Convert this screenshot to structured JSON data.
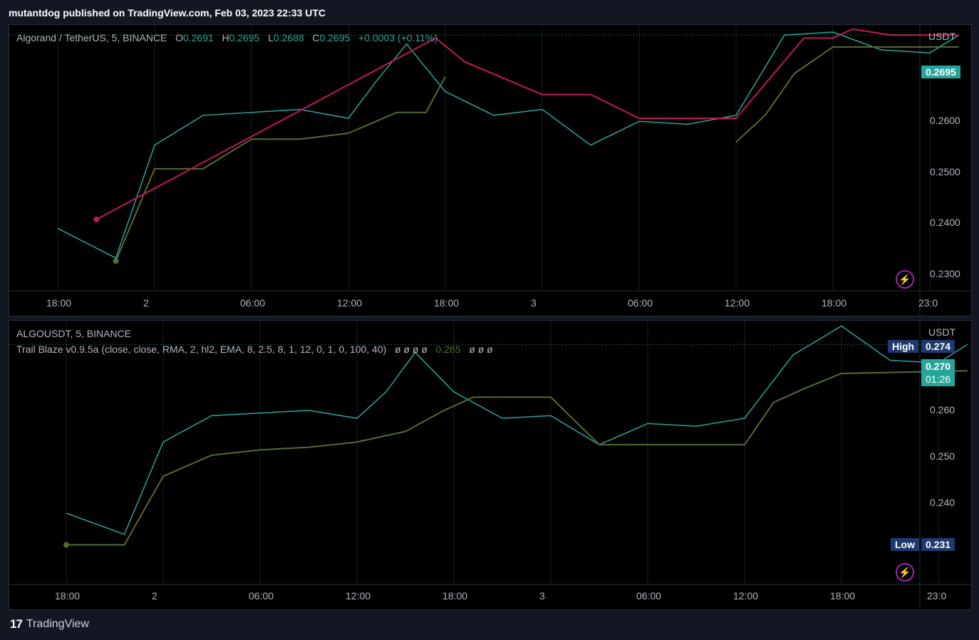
{
  "caption": "mutantdog published on TradingView.com, Feb 03, 2023 22:33 UTC",
  "footer": {
    "logo_mark": "17",
    "brand": "TradingView"
  },
  "colors": {
    "background": "#000000",
    "frame": "#131722",
    "up_candle": "#26a69a",
    "down_candle": "#ef5350",
    "trail_long": "#556b2f",
    "trail_short": "#c2185b",
    "last_price": "#26a69a",
    "high_low_tag": "#1e3a6e"
  },
  "time_axis": [
    "18:00",
    "2",
    "06:00",
    "12:00",
    "18:00",
    "3",
    "06:00",
    "12:00",
    "18:00",
    "23:0"
  ],
  "top_pane": {
    "legend": {
      "symbol": "Algorand / TetherUS, 5, BINANCE",
      "open_label": "O",
      "open": "0.2691",
      "high_label": "H",
      "high": "0.2695",
      "low_label": "L",
      "low": "0.2688",
      "close_label": "C",
      "close": "0.2695",
      "change": "+0.0003 (+0.11%)"
    },
    "currency": "USDT",
    "last_price": "0.2695",
    "price_ticks": [
      "0.2600",
      "0.2500",
      "0.2400",
      "0.2300"
    ]
  },
  "bottom_pane": {
    "legend": {
      "symbol": "ALGOUSDT, 5, BINANCE",
      "indicator": "Trail Blaze v0.9.5a (close, close, RMA, 2, hl2, EMA, 8, 2.5, 8, 1, 12, 0, 1, 0, 100, 40)",
      "values_a": "ø ø ø ø",
      "trail_value": "0.265",
      "values_b": "ø ø ø"
    },
    "currency": "USDT",
    "high_label": "High",
    "high_value": "0.274",
    "last_price": "0.270",
    "countdown": "01:26",
    "low_label": "Low",
    "low_value": "0.231",
    "price_ticks": [
      "0.260",
      "0.250",
      "0.240"
    ]
  },
  "chart_data": [
    {
      "type": "line",
      "title": "Algorand / TetherUS, 5, BINANCE",
      "x_labels": [
        "18:00",
        "2",
        "06:00",
        "12:00",
        "18:00",
        "3",
        "06:00",
        "12:00",
        "18:00",
        "23:0"
      ],
      "y_unit": "USDT",
      "ylim": [
        0.2265,
        0.2712
      ],
      "series": [
        {
          "name": "",
          "x": [
            0,
            0.6,
            1.0,
            1.5,
            2.0,
            2.5,
            3.0,
            3.3,
            3.6,
            4.0,
            4.5,
            5.0,
            5.5,
            6.0,
            6.5,
            7.0,
            7.5,
            8.0,
            8.5,
            9.0,
            9.3
          ],
          "y": [
            0.237,
            0.232,
            0.251,
            0.256,
            0.2565,
            0.257,
            0.2555,
            0.262,
            0.268,
            0.26,
            0.256,
            0.257,
            0.251,
            0.255,
            0.2545,
            0.256,
            0.2695,
            0.27,
            0.267,
            0.2665,
            0.2695
          ]
        },
        {
          "name": "",
          "x": [
            0.6,
            1.0,
            1.5,
            2.0,
            2.5,
            3.0,
            3.5,
            3.8,
            4.0,
            5.0,
            6.0,
            7.0,
            7.3,
            7.6,
            8.0,
            8.5,
            9.3
          ],
          "y": [
            0.2315,
            0.247,
            0.247,
            0.252,
            0.252,
            0.253,
            0.2565,
            0.2565,
            0.2625,
            null,
            null,
            0.2515,
            0.256,
            0.263,
            0.2675,
            0.2675,
            0.2675
          ]
        },
        {
          "name": "",
          "x": [
            0.4,
            3.9,
            4.2,
            5.0,
            5.5,
            6.0,
            7.0,
            7.7,
            8.0,
            8.2,
            8.6,
            9.3
          ],
          "y": [
            0.2385,
            0.269,
            0.265,
            0.2595,
            0.2595,
            0.2555,
            0.2555,
            0.269,
            0.269,
            0.2705,
            0.2695,
            0.2695
          ]
        }
      ]
    },
    {
      "type": "line",
      "title": "ALGOUSDT, 5, BINANCE",
      "x_labels": [
        "18:00",
        "2",
        "06:00",
        "12:00",
        "18:00",
        "3",
        "06:00",
        "12:00",
        "18:00",
        "23:0"
      ],
      "y_unit": "USDT",
      "ylim": [
        0.2245,
        0.2745
      ],
      "series": [
        {
          "name": "",
          "x": [
            0,
            0.6,
            1.0,
            1.5,
            2.0,
            2.5,
            3.0,
            3.3,
            3.6,
            4.0,
            4.5,
            5.0,
            5.5,
            6.0,
            6.5,
            7.0,
            7.5,
            8.0,
            8.5,
            9.0,
            9.3
          ],
          "y": [
            0.238,
            0.234,
            0.2515,
            0.2565,
            0.257,
            0.2575,
            0.256,
            0.261,
            0.2685,
            0.261,
            0.256,
            0.2565,
            0.251,
            0.255,
            0.2545,
            0.256,
            0.268,
            0.2735,
            0.267,
            0.2665,
            0.27
          ]
        },
        {
          "name": "",
          "x": [
            0,
            0.6,
            1.0,
            1.5,
            2.0,
            2.5,
            3.0,
            3.5,
            3.9,
            4.2,
            5.0,
            5.5,
            6.0,
            7.0,
            7.3,
            7.6,
            8.0,
            9.3
          ],
          "y": [
            0.232,
            0.232,
            0.245,
            0.249,
            0.25,
            0.2505,
            0.2515,
            0.2535,
            0.2575,
            0.26,
            0.26,
            0.251,
            0.251,
            0.251,
            0.259,
            0.2615,
            0.2645,
            0.265
          ]
        }
      ]
    }
  ]
}
